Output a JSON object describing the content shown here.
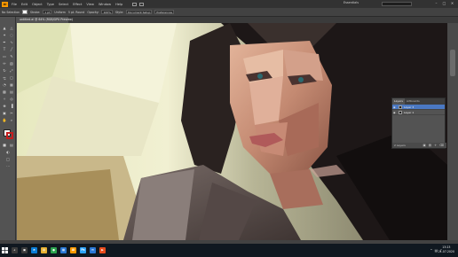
{
  "menubar": {
    "logo": "Ai",
    "items": [
      "File",
      "Edit",
      "Object",
      "Type",
      "Select",
      "Effect",
      "View",
      "Window",
      "Help"
    ],
    "workspace": "Essentials",
    "window_controls": [
      "–",
      "□",
      "✕"
    ]
  },
  "controlbar": {
    "selection_label": "No Selection",
    "stroke_label": "Stroke:",
    "weight": "1 pt",
    "uniform_label": "Uniform",
    "brush": "5 pt. Round",
    "opacity_label": "Opacity:",
    "opacity": "100%",
    "style_label": "Style:",
    "doc_setup": "Document Setup",
    "preferences": "Preferences"
  },
  "document": {
    "tab_label": "untitled.ai @ 64% (RGB/GPU Preview)"
  },
  "layers_panel": {
    "tabs": [
      "Layers",
      "Artboards"
    ],
    "layers": [
      {
        "name": "Layer 3",
        "selected": true
      },
      {
        "name": "Layer 1",
        "selected": false
      }
    ],
    "footer_count": "2 Layers",
    "footer_icons": [
      "▣",
      "▤",
      "+",
      "⌫"
    ]
  },
  "taskbar": {
    "apps": [
      {
        "name": "search",
        "glyph": "⌕",
        "color": "#3a3a3a"
      },
      {
        "name": "task-view",
        "glyph": "▣",
        "color": "#3a3a3a"
      },
      {
        "name": "edge",
        "glyph": "e",
        "color": "#0b7dd6"
      },
      {
        "name": "explorer",
        "glyph": "▤",
        "color": "#e8b030"
      },
      {
        "name": "chrome",
        "glyph": "●",
        "color": "#2da44e"
      },
      {
        "name": "store",
        "glyph": "▦",
        "color": "#2b78d6"
      },
      {
        "name": "illustrator",
        "glyph": "Ai",
        "color": "#ff9a00"
      },
      {
        "name": "photoshop",
        "glyph": "Ps",
        "color": "#2fa3f7"
      },
      {
        "name": "mail",
        "glyph": "✉",
        "color": "#2b78d6"
      },
      {
        "name": "media",
        "glyph": "▶",
        "color": "#e84c1d"
      }
    ],
    "time": "13:23",
    "date": "21.07.2020"
  },
  "colors": {
    "accent": "#4a78c2",
    "fill": "#ffffff",
    "stroke": "#c41c1c"
  }
}
